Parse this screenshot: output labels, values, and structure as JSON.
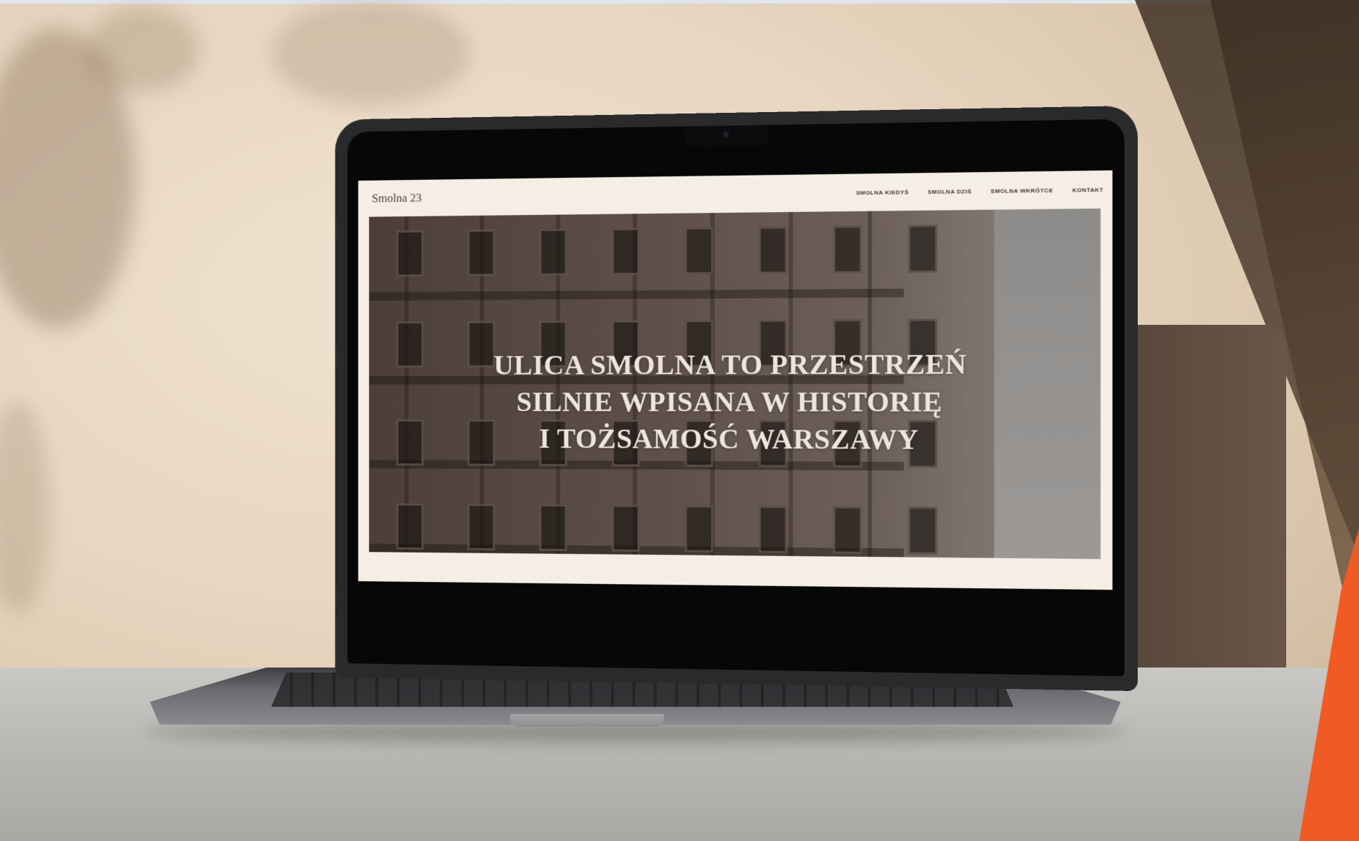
{
  "website": {
    "logo": "Smolna 23",
    "nav": [
      {
        "label": "SMOLNA KIEDYŚ"
      },
      {
        "label": "SMOLNA DZIŚ"
      },
      {
        "label": "SMOLNA WKRÓTCE"
      },
      {
        "label": "KONTAKT"
      }
    ],
    "hero": {
      "lines": [
        "ULICA SMOLNA TO PRZESTRZEŃ",
        "SILNIE WPISANA W HISTORIĘ",
        "I TOŻSAMOŚĆ WARSZAWY"
      ]
    }
  },
  "colors": {
    "accent_orange": "#f05a24"
  }
}
